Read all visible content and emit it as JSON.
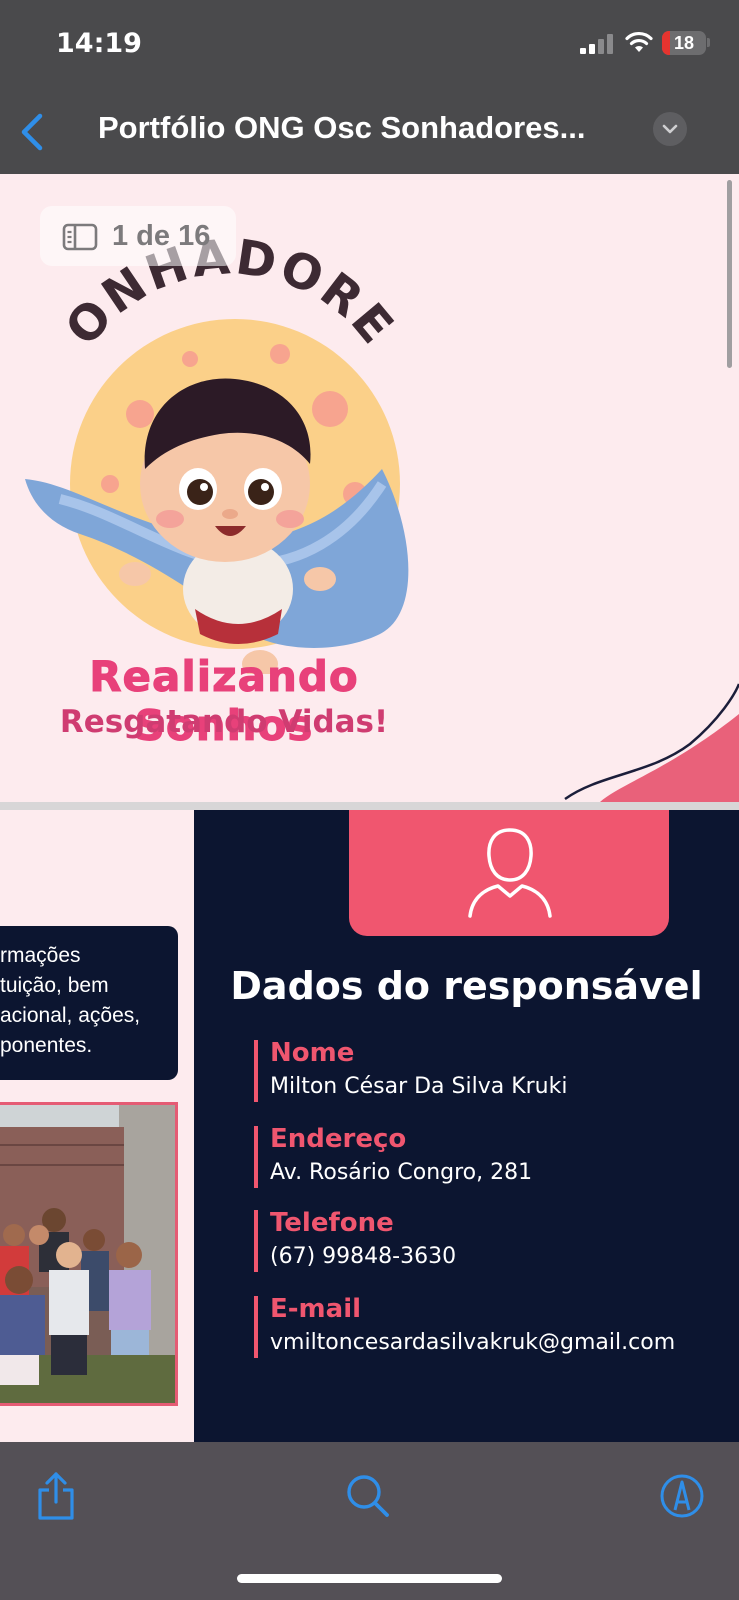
{
  "status_bar": {
    "time": "14:19",
    "battery_level": "18",
    "battery_fraction": 0.18
  },
  "nav": {
    "title": "Portfólio ONG Osc Sonhadores..."
  },
  "page_indicator": {
    "text": "1 de 16"
  },
  "slide1": {
    "logo_word": "SONHADORES",
    "slogan_line1": "Realizando Sonhos",
    "slogan_line2": "Resgatando Vidas!"
  },
  "slide2": {
    "info_lines": [
      "rmações",
      "tuição, bem",
      "acional, ações,",
      "ponentes."
    ],
    "section_title": "Dados do responsável",
    "fields": [
      {
        "label": "Nome",
        "value": "Milton César Da Silva Kruki"
      },
      {
        "label": "Endereço",
        "value": "Av. Rosário Congro, 281"
      },
      {
        "label": "Telefone",
        "value": "(67) 99848-3630"
      },
      {
        "label": "E-mail",
        "value": "vmiltoncesardasilvakruk@gmail.com"
      }
    ]
  },
  "colors": {
    "accent": "#2f8ee8",
    "navy": "#0c1530",
    "coral": "#f0566f",
    "pink_text": "#e8417a",
    "page_bg": "#fdebee"
  },
  "icons": {
    "back": "chevron-left-icon",
    "more": "chevron-down-icon",
    "page": "sidebar-icon",
    "share": "share-icon",
    "search": "search-icon",
    "markup": "markup-pen-icon",
    "person": "person-icon"
  }
}
